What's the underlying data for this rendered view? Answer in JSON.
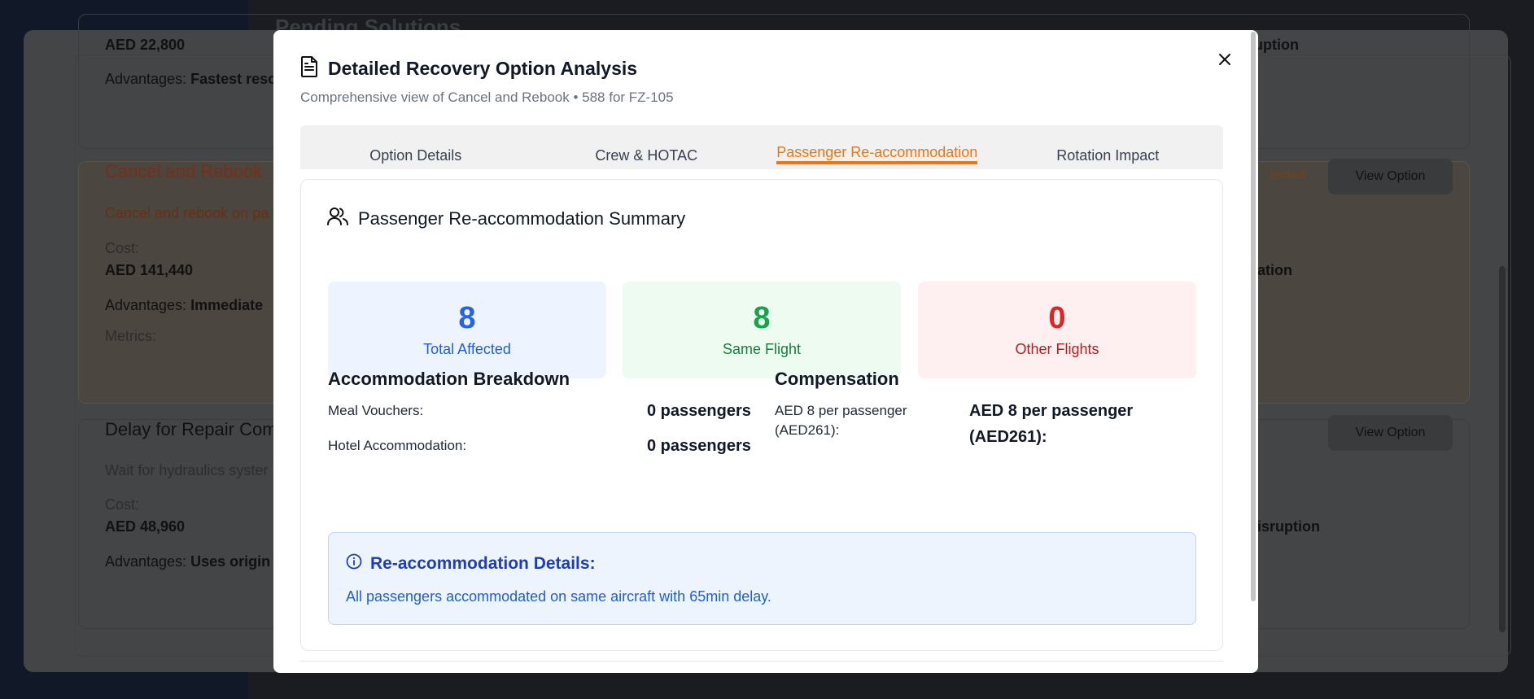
{
  "background": {
    "page_title": "Pending Solutions",
    "card1": {
      "cost": "AED 22,800",
      "advantages_label": "Advantages:",
      "advantages_value": "Fastest reso",
      "right_text": "ruption"
    },
    "card2": {
      "title": "Cancel and Rebook",
      "desc": "Cancel and rebook on pa",
      "cost_label": "Cost:",
      "cost": "AED 141,440",
      "advantages_label": "Advantages:",
      "advantages_value": "Immediate",
      "metrics_label": "Metrics:",
      "right_text": "lation",
      "badge": "lected",
      "view_option": "View Option"
    },
    "card3": {
      "title": "Delay for Repair Com",
      "desc": "Wait for hydraulics syster",
      "cost_label": "Cost:",
      "cost": "AED 48,960",
      "advantages_label": "Advantages:",
      "advantages_value": "Uses origin",
      "right_text": "disruption",
      "view_option": "View Option"
    }
  },
  "modal": {
    "title": "Detailed Recovery Option Analysis",
    "subtitle": "Comprehensive view of Cancel and Rebook • 588 for FZ-105",
    "tabs": [
      {
        "label": "Option Details"
      },
      {
        "label": "Crew & HOTAC"
      },
      {
        "label": "Passenger Re-accommodation"
      },
      {
        "label": "Rotation Impact"
      }
    ],
    "active_tab": 2,
    "summary": {
      "title": "Passenger Re-accommodation Summary",
      "stats": [
        {
          "value": "8",
          "label": "Total Affected"
        },
        {
          "value": "8",
          "label": "Same Flight"
        },
        {
          "value": "0",
          "label": "Other Flights"
        }
      ]
    },
    "breakdown": {
      "title": "Accommodation Breakdown",
      "rows": [
        {
          "label": "Meal Vouchers:",
          "value": "0 passengers"
        },
        {
          "label": "Hotel Accommodation:",
          "value": "0 passengers"
        }
      ]
    },
    "compensation": {
      "title": "Compensation",
      "label": "AED 8 per passenger (AED261):",
      "value": "AED 8 per passenger (AED261):"
    },
    "details": {
      "title": "Re-accommodation Details:",
      "text": "All passengers accommodated on same aircraft with 65min delay."
    }
  },
  "colors": {
    "accent": "#f2740d",
    "blue": "#2563eb",
    "green": "#16a34a",
    "red": "#dc2626"
  }
}
